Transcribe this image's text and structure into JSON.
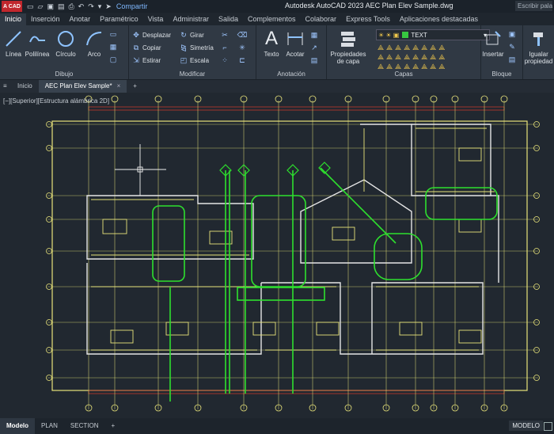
{
  "titlebar": {
    "logo": "A CAD",
    "share": "Compartir",
    "title": "Autodesk AutoCAD 2023     AEC Plan Elev Sample.dwg",
    "search_placeholder": "Escribir pala"
  },
  "ribbon_tabs": [
    "Inicio",
    "Inserción",
    "Anotar",
    "Paramétrico",
    "Vista",
    "Administrar",
    "Salida",
    "Complementos",
    "Colaborar",
    "Express Tools",
    "Aplicaciones destacadas"
  ],
  "draw_panel": {
    "title": "Dibujo",
    "tools": [
      "Línea",
      "Polilínea",
      "Círculo",
      "Arco"
    ]
  },
  "modify_panel": {
    "title": "Modificar",
    "tools": [
      "Desplazar",
      "Girar",
      "Copiar",
      "Simetría",
      "Estirar",
      "Escala"
    ]
  },
  "annotation_panel": {
    "title": "Anotación",
    "tools": [
      "Texto",
      "Acotar"
    ]
  },
  "layers_panel": {
    "title": "Capas",
    "properties_label": "Propiedades de capa",
    "current_layer": "TEXT",
    "accent": "#37c840"
  },
  "block_panel": {
    "title": "Bloque",
    "insert_label": "Insertar"
  },
  "properties_panel": {
    "match_label": "Igualar propiedad"
  },
  "doc_tabs": {
    "start": "Inicio",
    "active": "AEC Plan Elev Sample*",
    "close": "×",
    "add": "+"
  },
  "viewport": {
    "label": "[−][Superior][Estructura alámbrica 2D]"
  },
  "status": {
    "tabs": [
      "Modelo",
      "PLAN",
      "SECTION"
    ],
    "add": "+",
    "mode": "MODELO"
  },
  "colors": {
    "drawing_yellow": "#e8e37a",
    "drawing_green": "#2ee02e",
    "drawing_white": "#e6e6e6",
    "background": "#212830"
  }
}
